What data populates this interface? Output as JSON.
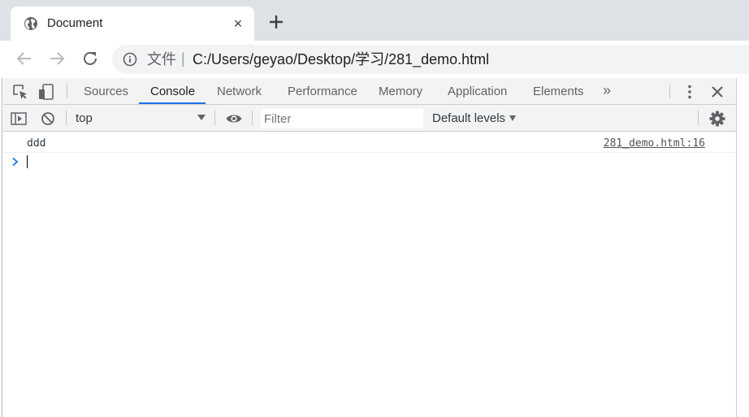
{
  "browser": {
    "tab_title": "Document",
    "tab_close_glyph": "×",
    "url_scheme": "文件",
    "url_separator": "|",
    "url": "C:/Users/geyao/Desktop/学习/281_demo.html"
  },
  "devtools": {
    "tabs": [
      {
        "label": "Sources",
        "active": false
      },
      {
        "label": "Console",
        "active": true
      },
      {
        "label": "Network",
        "active": false
      },
      {
        "label": "Performance",
        "active": false
      },
      {
        "label": "Memory",
        "active": false
      },
      {
        "label": "Application",
        "active": false
      },
      {
        "label": "Elements",
        "active": false
      }
    ],
    "more_tabs_glyph": "»",
    "context": "top",
    "filter_placeholder": "Filter",
    "levels_label": "Default levels",
    "accent_color": "#1a73e8"
  },
  "console": {
    "messages": [
      {
        "text": "ddd",
        "source": "281_demo.html:16"
      }
    ],
    "prompt_glyph": "chevron-right-icon"
  }
}
